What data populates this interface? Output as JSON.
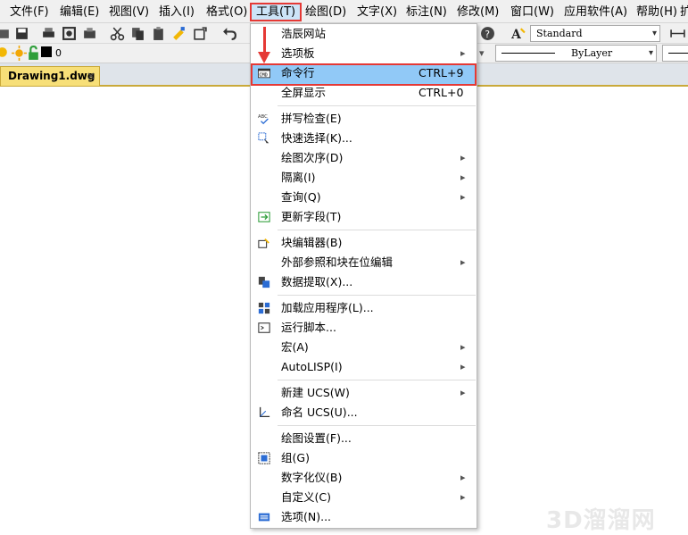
{
  "menubar": [
    {
      "label": "文件(F)",
      "active": false
    },
    {
      "label": "编辑(E)",
      "active": false
    },
    {
      "label": "视图(V)",
      "active": false
    },
    {
      "label": "插入(I)",
      "active": false
    },
    {
      "label": "格式(O)",
      "active": false
    },
    {
      "label": "工具(T)",
      "active": true
    },
    {
      "label": "绘图(D)",
      "active": false
    },
    {
      "label": "文字(X)",
      "active": false
    },
    {
      "label": "标注(N)",
      "active": false
    },
    {
      "label": "修改(M)",
      "active": false
    },
    {
      "label": "窗口(W)",
      "active": false
    },
    {
      "label": "应用软件(A)",
      "active": false
    },
    {
      "label": "帮助(H)",
      "active": false
    },
    {
      "label": "扩",
      "active": false
    }
  ],
  "toolbar": {
    "text_style": "Standard",
    "linetype": "ByLayer",
    "layer_name": "0"
  },
  "document_tab": {
    "label": "Drawing1.dwg",
    "close": "×"
  },
  "tools_menu": {
    "items": [
      {
        "label": "浩辰网站",
        "shortcut": "",
        "submenu": false,
        "icon": "",
        "highlighted": false
      },
      {
        "label": "选项板",
        "shortcut": "",
        "submenu": true,
        "icon": "",
        "highlighted": false
      },
      {
        "label": "命令行",
        "shortcut": "CTRL+9",
        "submenu": false,
        "icon": "command-line-icon",
        "highlighted": true
      },
      {
        "label": "全屏显示",
        "shortcut": "CTRL+0",
        "submenu": false,
        "icon": "",
        "highlighted": false
      },
      {
        "label": "拼写检查(E)",
        "shortcut": "",
        "submenu": false,
        "icon": "spellcheck-icon",
        "highlighted": false
      },
      {
        "label": "快速选择(K)...",
        "shortcut": "",
        "submenu": false,
        "icon": "quick-select-icon",
        "highlighted": false
      },
      {
        "label": "绘图次序(D)",
        "shortcut": "",
        "submenu": true,
        "icon": "",
        "highlighted": false
      },
      {
        "label": "隔离(I)",
        "shortcut": "",
        "submenu": true,
        "icon": "",
        "highlighted": false
      },
      {
        "label": "查询(Q)",
        "shortcut": "",
        "submenu": true,
        "icon": "",
        "highlighted": false
      },
      {
        "label": "更新字段(T)",
        "shortcut": "",
        "submenu": false,
        "icon": "update-field-icon",
        "highlighted": false
      },
      {
        "label": "块编辑器(B)",
        "shortcut": "",
        "submenu": false,
        "icon": "block-editor-icon",
        "highlighted": false
      },
      {
        "label": "外部参照和块在位编辑",
        "shortcut": "",
        "submenu": true,
        "icon": "",
        "highlighted": false
      },
      {
        "label": "数据提取(X)...",
        "shortcut": "",
        "submenu": false,
        "icon": "data-extract-icon",
        "highlighted": false
      },
      {
        "label": "加载应用程序(L)...",
        "shortcut": "",
        "submenu": false,
        "icon": "load-app-icon",
        "highlighted": false
      },
      {
        "label": "运行脚本...",
        "shortcut": "",
        "submenu": false,
        "icon": "run-script-icon",
        "highlighted": false
      },
      {
        "label": "宏(A)",
        "shortcut": "",
        "submenu": true,
        "icon": "",
        "highlighted": false
      },
      {
        "label": "AutoLISP(I)",
        "shortcut": "",
        "submenu": true,
        "icon": "",
        "highlighted": false
      },
      {
        "label": "新建 UCS(W)",
        "shortcut": "",
        "submenu": true,
        "icon": "",
        "highlighted": false
      },
      {
        "label": "命名 UCS(U)...",
        "shortcut": "",
        "submenu": false,
        "icon": "named-ucs-icon",
        "highlighted": false
      },
      {
        "label": "绘图设置(F)...",
        "shortcut": "",
        "submenu": false,
        "icon": "",
        "highlighted": false
      },
      {
        "label": "组(G)",
        "shortcut": "",
        "submenu": false,
        "icon": "group-icon",
        "highlighted": false
      },
      {
        "label": "数字化仪(B)",
        "shortcut": "",
        "submenu": true,
        "icon": "",
        "highlighted": false
      },
      {
        "label": "自定义(C)",
        "shortcut": "",
        "submenu": true,
        "icon": "",
        "highlighted": false
      },
      {
        "label": "选项(N)...",
        "shortcut": "",
        "submenu": false,
        "icon": "options-icon",
        "highlighted": false
      }
    ]
  },
  "watermark": "3D溜溜网",
  "colors": {
    "highlight": "#91c9f7",
    "annotation_red": "#e53935",
    "tab_yellow": "#f7df78"
  }
}
